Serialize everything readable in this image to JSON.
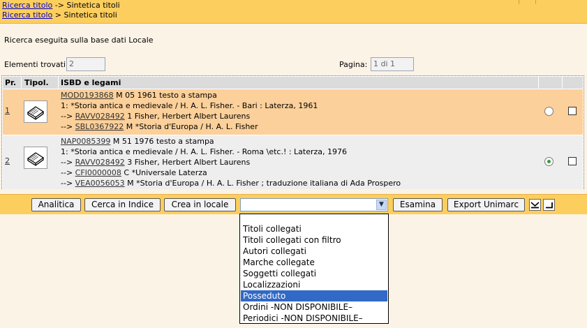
{
  "breadcrumbs": [
    {
      "link": "Ricerca titolo",
      "sep": " -> ",
      "current": "Sintetica titoli"
    },
    {
      "link": "Ricerca titolo",
      "sep": " > ",
      "current": "Sintetica titoli"
    }
  ],
  "search_info": "Ricerca eseguita sulla base dati Locale",
  "found": {
    "label": "Elementi trovati:",
    "value": "2"
  },
  "page": {
    "label": "Pagina:",
    "value": "1 di 1"
  },
  "table": {
    "headers": {
      "pr": "Pr.",
      "tipol": "Tipol.",
      "isbd": "ISBD e legami"
    },
    "rows": [
      {
        "num": "1",
        "lines": [
          {
            "code": "MOD0193868",
            "text": " M 05 1961 testo a stampa"
          },
          {
            "prefix": "",
            "code": "",
            "text": "1: *Storia antica e medievale / H. A. L. Fisher. - Bari : Laterza, 1961"
          },
          {
            "prefix": "--> ",
            "code": "RAVV028492",
            "text": " 1 Fisher, Herbert Albert Laurens"
          },
          {
            "prefix": "--> ",
            "code": "SBL0367922",
            "text": " M *Storia d'Europa / H. A. L. Fisher"
          }
        ],
        "radio_selected": false
      },
      {
        "num": "2",
        "lines": [
          {
            "code": "NAP0085399",
            "text": " M 51 1976 testo a stampa"
          },
          {
            "prefix": "",
            "code": "",
            "text": "1: *Storia antica e medievale / H. A. L. Fisher. - Roma \\etc.! : Laterza, 1976"
          },
          {
            "prefix": "--> ",
            "code": "RAVV028492",
            "text": " 3 Fisher, Herbert Albert Laurens"
          },
          {
            "prefix": "--> ",
            "code": "CFI0000008",
            "text": " C *Universale Laterza"
          },
          {
            "prefix": "--> ",
            "code": "VEA0056053",
            "text": " M *Storia d'Europa / H. A. L. Fisher ; traduzione italiana di Ada Prospero"
          }
        ],
        "radio_selected": true
      }
    ]
  },
  "toolbar": {
    "analitica": "Analitica",
    "cerca_indice": "Cerca in Indice",
    "crea_locale": "Crea in locale",
    "combo_value": "",
    "esamina": "Esamina",
    "export": "Export Unimarc"
  },
  "dropdown_options": [
    {
      "label": "",
      "selected": false
    },
    {
      "label": "Titoli collegati",
      "selected": false
    },
    {
      "label": "Titoli collegati con filtro",
      "selected": false
    },
    {
      "label": "Autori collegati",
      "selected": false
    },
    {
      "label": "Marche collegate",
      "selected": false
    },
    {
      "label": "Soggetti collegati",
      "selected": false
    },
    {
      "label": "Localizzazioni",
      "selected": false
    },
    {
      "label": "Posseduto",
      "selected": true
    },
    {
      "label": "Ordini -NON DISPONIBILE–",
      "selected": false
    },
    {
      "label": "Periodici -NON DISPONIBILE–",
      "selected": false
    }
  ],
  "colors": {
    "header_bar": "#fcce5e",
    "row_selected_bg": "#fcd09a",
    "option_highlight": "#3169c6"
  }
}
